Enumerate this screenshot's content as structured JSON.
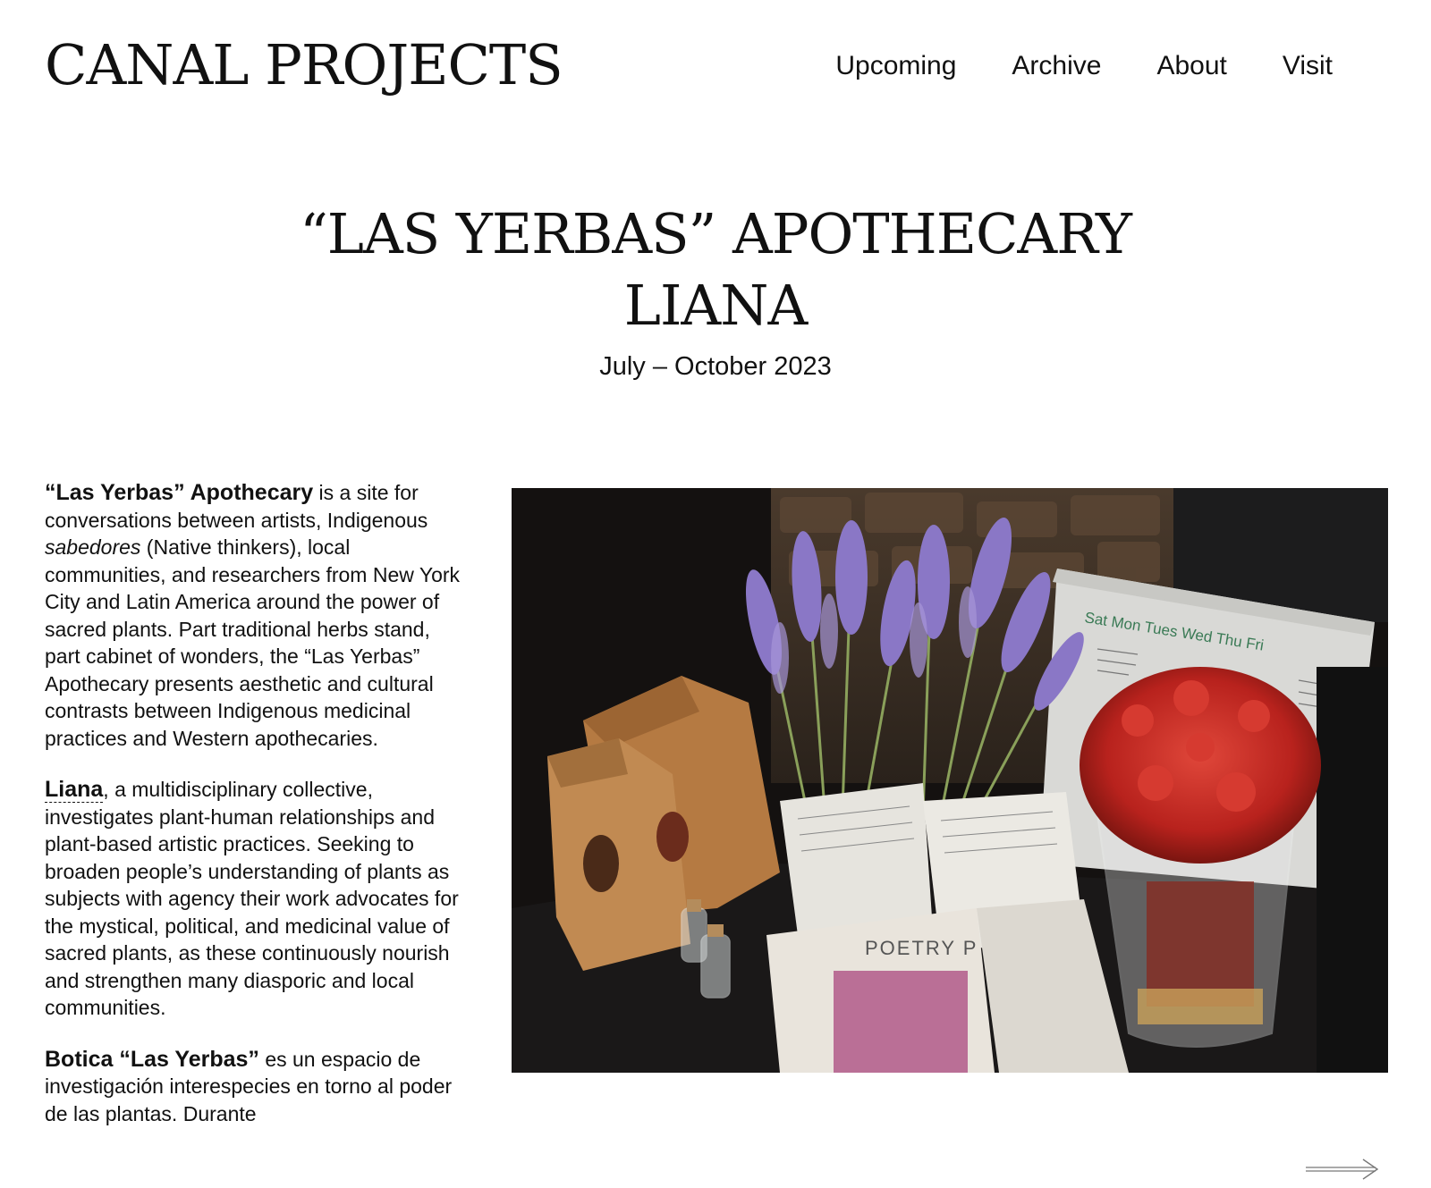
{
  "header": {
    "logo": "CANAL PROJECTS",
    "nav": [
      "Upcoming",
      "Archive",
      "About",
      "Visit"
    ]
  },
  "title": {
    "line1": "“LAS YERBAS” APOTHECARY",
    "line2": "LIANA",
    "dates": "July – October 2023"
  },
  "body": {
    "p1_bold": "“Las Yerbas” Apothecary",
    "p1_a": " is a site for conversations between artists, Indigenous ",
    "p1_em": "sabedores",
    "p1_b": " (Native thinkers), local communities, and researchers from New York City and Latin America around the power of sacred plants. Part traditional herbs stand, part cabinet of wonders, the “Las Yerbas” Apothecary presents aesthetic and cultural contrasts between Indigenous medicinal practices and Western apothecaries.",
    "p2_link": "Liana",
    "p2_text": ", a multidisciplinary collective, investigates plant-human relationships and plant-based artistic practices. Seeking to broaden people’s understanding of plants as subjects with agency their work advocates for the mystical, political, and medicinal value of sacred plants, as these continuously nourish and strengthen many diasporic and local communities.",
    "p3_bold": "Botica “Las Yerbas”",
    "p3_text": " es un espacio de investigación interespecies en torno al poder de las plantas. Durante"
  },
  "photo": {
    "planner_days": "Sat  Mon  Tues  Wed  Thu  Fri",
    "packet_label": "POETRY P"
  },
  "icons": {
    "next": "arrow-right-icon"
  }
}
